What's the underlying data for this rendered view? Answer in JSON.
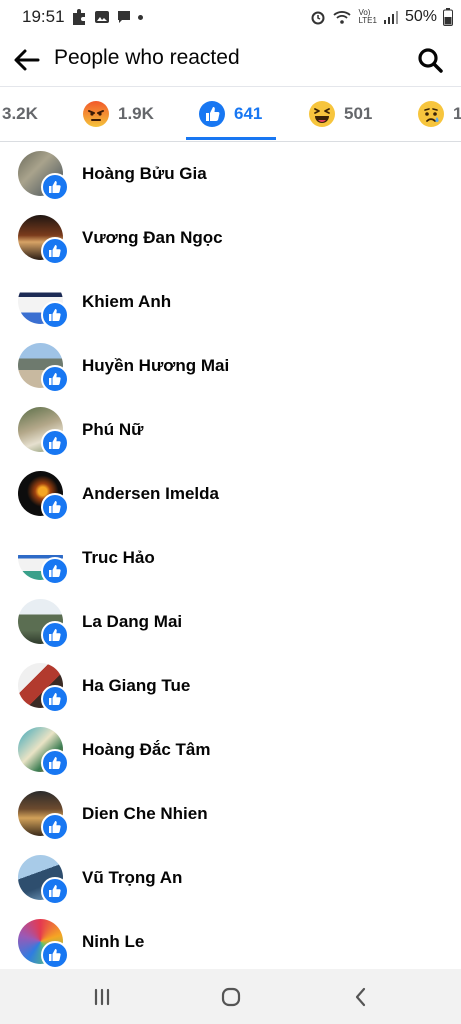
{
  "status_bar": {
    "time": "19:51",
    "battery": "50%",
    "left_icons": [
      "puzzle-icon",
      "image-icon",
      "message-icon",
      "dot-icon"
    ],
    "right_icons": [
      "alarm-icon",
      "wifi-icon",
      "volte-icon",
      "signal-icon",
      "battery-icon"
    ],
    "volte_line1": "Vo)",
    "volte_line2": "LTE1"
  },
  "header": {
    "title": "People who reacted"
  },
  "tabs": [
    {
      "icon": "all",
      "count": "3.2K"
    },
    {
      "icon": "angry-icon",
      "count": "1.9K"
    },
    {
      "icon": "like-icon",
      "count": "641",
      "active": true
    },
    {
      "icon": "haha-icon",
      "count": "501"
    },
    {
      "icon": "sad-icon",
      "count": "1"
    }
  ],
  "people": [
    {
      "name": "Hoàng Bửu Gia"
    },
    {
      "name": "Vương Đan Ngọc"
    },
    {
      "name": "Khiem Anh"
    },
    {
      "name": "Huyền Hương Mai"
    },
    {
      "name": "Phú Nữ"
    },
    {
      "name": "Andersen Imelda"
    },
    {
      "name": "Truc Hảo"
    },
    {
      "name": "La Dang Mai"
    },
    {
      "name": "Ha Giang Tue"
    },
    {
      "name": "Hoàng Đắc Tâm"
    },
    {
      "name": "Dien Che Nhien"
    },
    {
      "name": "Vũ Trọng An"
    },
    {
      "name": "Ninh Le"
    }
  ],
  "colors": {
    "accent": "#1877f2",
    "text": "#050505",
    "muted": "#65676b"
  }
}
